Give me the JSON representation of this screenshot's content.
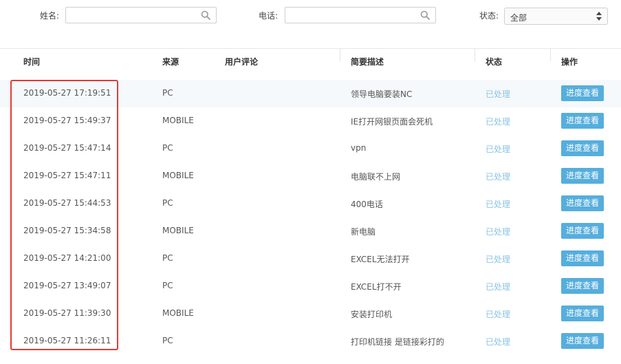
{
  "filters": {
    "name_label": "姓名:",
    "name_value": "",
    "phone_label": "电话:",
    "phone_value": "",
    "status_label": "状态:",
    "status_value": "全部"
  },
  "table": {
    "headers": [
      "时间",
      "来源",
      "用户评论",
      "简要描述",
      "状态",
      "操作"
    ],
    "rows": [
      {
        "time": "2019-05-27 17:19:51",
        "source": "PC",
        "comment": "",
        "desc": "领导电脑要装NC",
        "status": "已处理",
        "action": "进度查看"
      },
      {
        "time": "2019-05-27 15:49:37",
        "source": "MOBILE",
        "comment": "",
        "desc": "IE打开网银页面会死机",
        "status": "已处理",
        "action": "进度查看"
      },
      {
        "time": "2019-05-27 15:47:14",
        "source": "PC",
        "comment": "",
        "desc": "vpn",
        "status": "已处理",
        "action": "进度查看"
      },
      {
        "time": "2019-05-27 15:47:11",
        "source": "MOBILE",
        "comment": "",
        "desc": "电脑联不上网",
        "status": "已处理",
        "action": "进度查看"
      },
      {
        "time": "2019-05-27 15:44:53",
        "source": "PC",
        "comment": "",
        "desc": "400电话",
        "status": "已处理",
        "action": "进度查看"
      },
      {
        "time": "2019-05-27 15:34:58",
        "source": "MOBILE",
        "comment": "",
        "desc": "新电脑",
        "status": "已处理",
        "action": "进度查看"
      },
      {
        "time": "2019-05-27 14:21:00",
        "source": "PC",
        "comment": "",
        "desc": "EXCEL无法打开",
        "status": "已处理",
        "action": "进度查看"
      },
      {
        "time": "2019-05-27 13:49:07",
        "source": "PC",
        "comment": "",
        "desc": "EXCEL打不开",
        "status": "已处理",
        "action": "进度查看"
      },
      {
        "time": "2019-05-27 11:39:30",
        "source": "MOBILE",
        "comment": "",
        "desc": "安装打印机",
        "status": "已处理",
        "action": "进度查看"
      },
      {
        "time": "2019-05-27 11:26:11",
        "source": "PC",
        "comment": "",
        "desc": "打印机链接 是链接彩打的",
        "status": "已处理",
        "action": "进度查看"
      }
    ]
  },
  "colors": {
    "accent": "#56aedd",
    "status_text": "#8cc3e3",
    "highlight_border": "#e53935"
  },
  "icons": {
    "search": "search-icon",
    "select_arrows": "updown-arrows-icon"
  }
}
